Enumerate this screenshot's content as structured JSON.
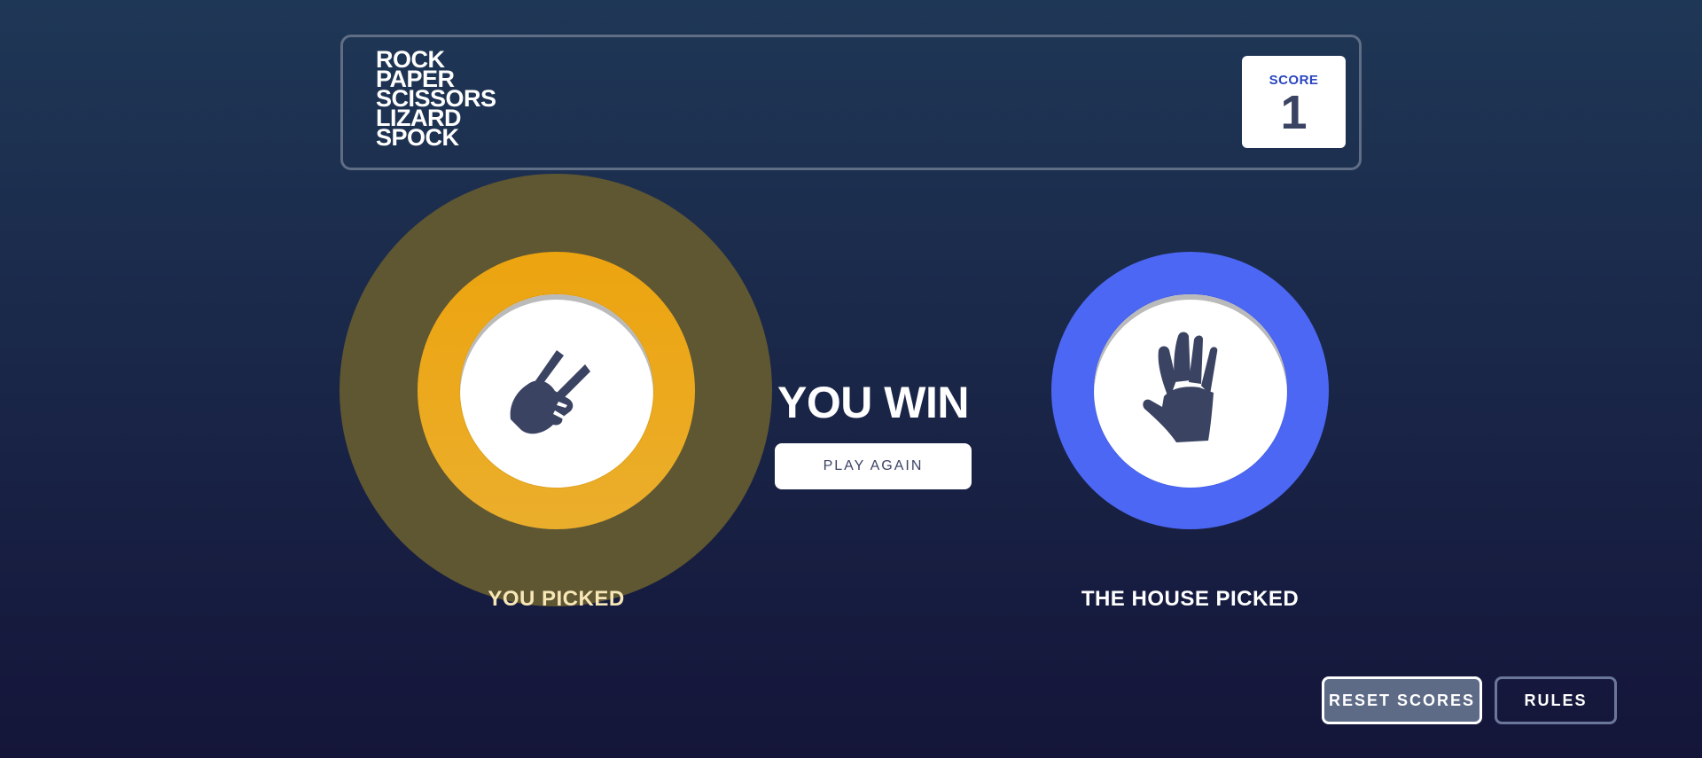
{
  "header": {
    "title_lines": [
      "ROCK",
      "PAPER",
      "SCISSORS",
      "LIZARD",
      "SPOCK"
    ],
    "score_label": "SCORE",
    "score_value": "1"
  },
  "game": {
    "user_pick": {
      "label": "YOU PICKED",
      "choice_icon": "scissors-icon",
      "ring_color": "#eca40f"
    },
    "house_pick": {
      "label": "THE HOUSE PICKED",
      "choice_icon": "paper-icon",
      "ring_color": "#4c67f4"
    },
    "result": "YOU WIN",
    "play_again_label": "PLAY AGAIN"
  },
  "footer": {
    "reset_label": "RESET SCORES",
    "rules_label": "RULES"
  }
}
